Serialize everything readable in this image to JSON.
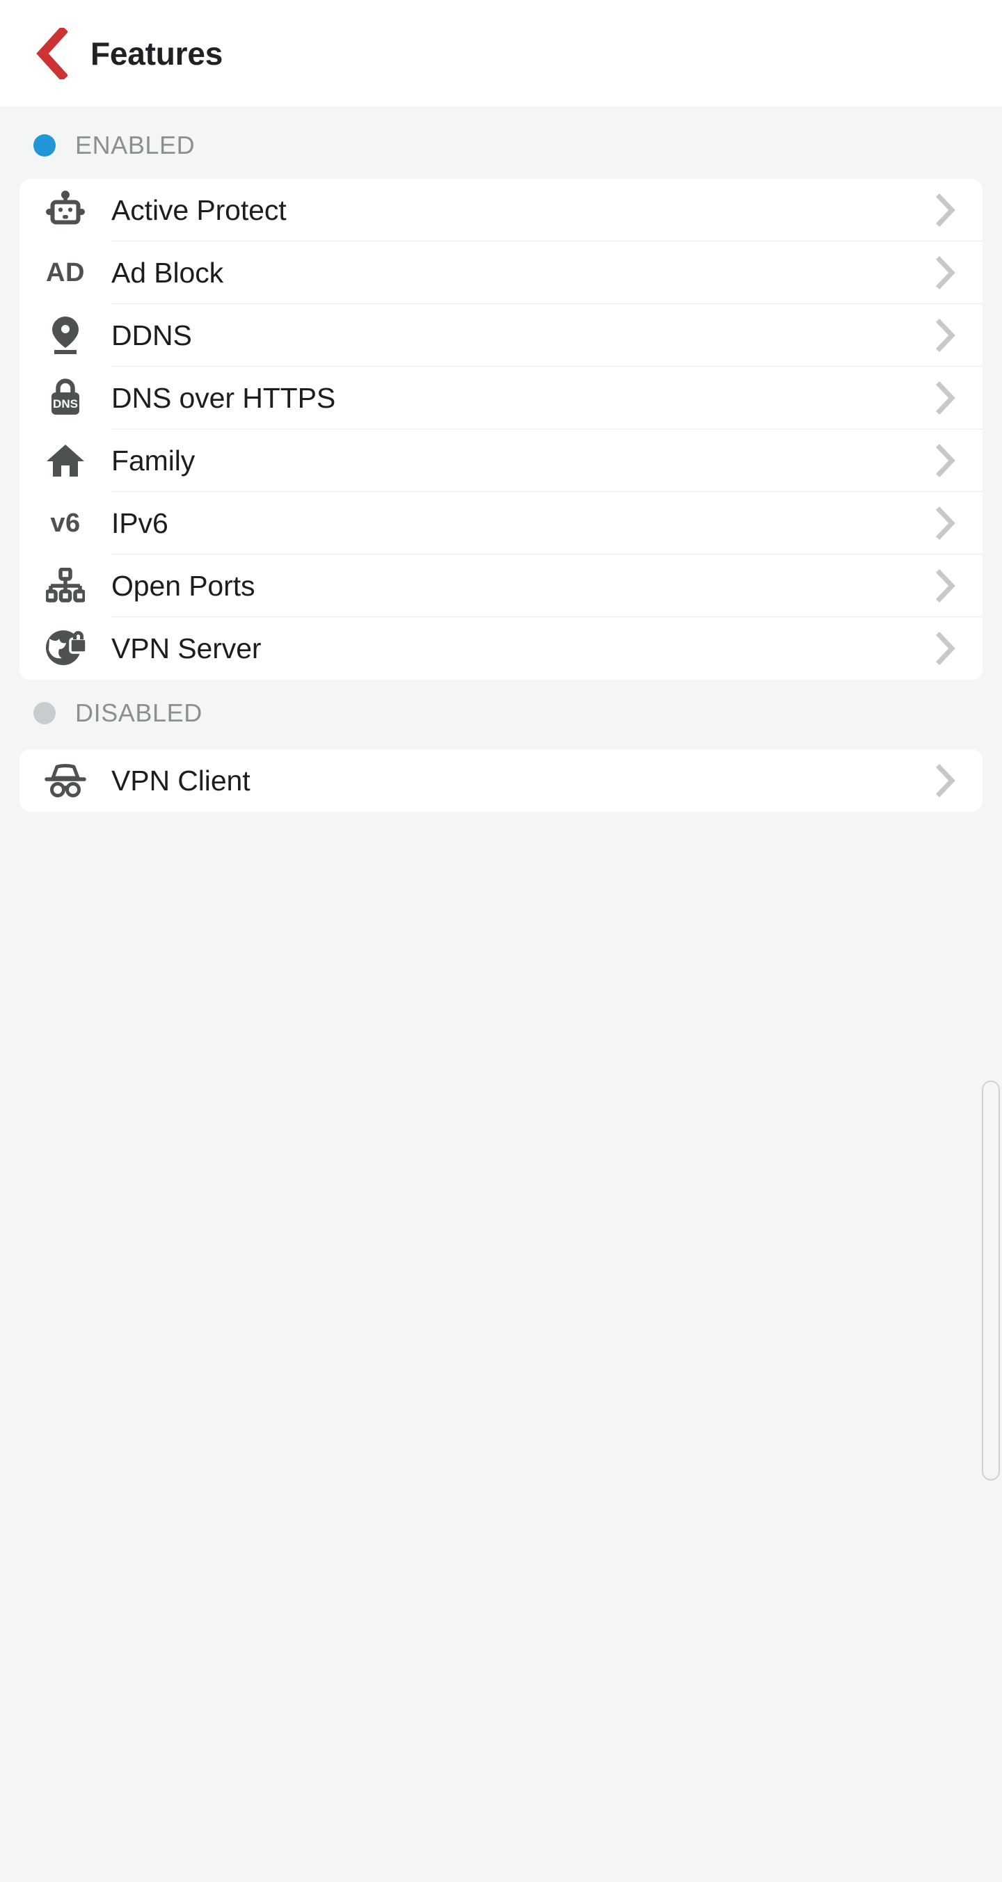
{
  "header": {
    "title": "Features",
    "back_icon": "chevron-left-icon",
    "back_color": "#cc3333"
  },
  "sections": [
    {
      "id": "enabled",
      "label": "ENABLED",
      "dot_color": "#2196d8",
      "items": [
        {
          "label": "Active Protect",
          "icon": "robot-icon",
          "chevron": "chevron-right-icon"
        },
        {
          "label": "Ad Block",
          "icon": "ad-text-icon",
          "icon_text": "AD",
          "chevron": "chevron-right-icon"
        },
        {
          "label": "DDNS",
          "icon": "map-pin-icon",
          "chevron": "chevron-right-icon"
        },
        {
          "label": "DNS over HTTPS",
          "icon": "dns-lock-icon",
          "icon_text": "DNS",
          "chevron": "chevron-right-icon"
        },
        {
          "label": "Family",
          "icon": "home-icon",
          "chevron": "chevron-right-icon"
        },
        {
          "label": "IPv6",
          "icon": "v6-text-icon",
          "icon_text": "v6",
          "chevron": "chevron-right-icon"
        },
        {
          "label": "Open Ports",
          "icon": "network-tree-icon",
          "chevron": "chevron-right-icon"
        },
        {
          "label": "VPN Server",
          "icon": "globe-lock-icon",
          "chevron": "chevron-right-icon"
        }
      ]
    },
    {
      "id": "disabled",
      "label": "DISABLED",
      "dot_color": "#c9ccce",
      "items": [
        {
          "label": "VPN Client",
          "icon": "incognito-icon",
          "chevron": "chevron-right-icon"
        }
      ]
    }
  ],
  "scrollbar": {
    "visible": true
  }
}
